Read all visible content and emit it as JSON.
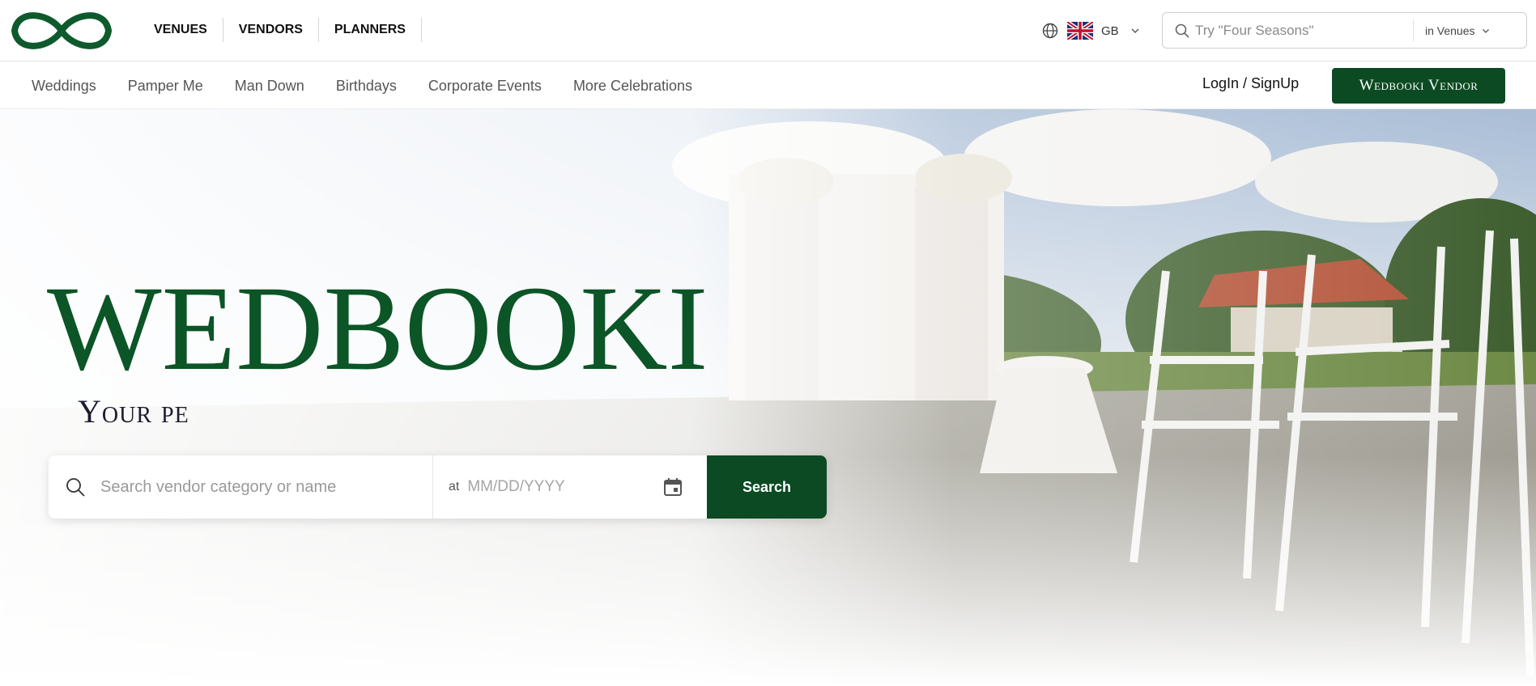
{
  "header": {
    "nav": [
      {
        "label": "VENUES"
      },
      {
        "label": "VENDORS"
      },
      {
        "label": "PLANNERS"
      }
    ],
    "language": {
      "code": "GB",
      "icon": "globe-icon",
      "flag": "uk-flag-icon"
    },
    "search": {
      "placeholder": "Try \"Four Seasons\"",
      "scope": "in Venues"
    }
  },
  "categories": [
    {
      "label": "Weddings"
    },
    {
      "label": "Pamper Me"
    },
    {
      "label": "Man Down"
    },
    {
      "label": "Birthdays"
    },
    {
      "label": "Corporate Events"
    },
    {
      "label": "More Celebrations"
    }
  ],
  "account": {
    "login_label": "LogIn / SignUp",
    "vendor_label": "Wedbooki Vendor"
  },
  "hero": {
    "brand": "WEDBOOKI",
    "tagline": "Your pe",
    "search": {
      "query_placeholder": "Search vendor category or name",
      "date_prefix": "at",
      "date_placeholder": "MM/DD/YYYY",
      "button_label": "Search"
    }
  },
  "colors": {
    "brand_green": "#0b4a22",
    "logo_green": "#0e5a2c"
  }
}
